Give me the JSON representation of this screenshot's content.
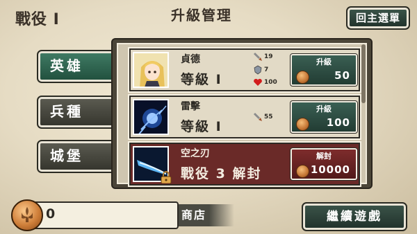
{
  "header": {
    "battle": "戰役 I",
    "title": "升級管理",
    "back_button": "回主選單"
  },
  "tabs": [
    {
      "label": "英雄",
      "active": true
    },
    {
      "label": "兵種",
      "active": false
    },
    {
      "label": "城堡",
      "active": false
    }
  ],
  "units": [
    {
      "name": "貞德",
      "level_text": "等級 I",
      "stats": {
        "attack": "19",
        "defense": "7",
        "hp": "100"
      },
      "action_label": "升級",
      "price": "50",
      "locked": false,
      "icon": "heroine-portrait"
    },
    {
      "name": "雷擊",
      "level_text": "等級 I",
      "stats": {
        "attack": "55"
      },
      "action_label": "升級",
      "price": "100",
      "locked": false,
      "icon": "lightning-orb-icon"
    },
    {
      "name": "空之刃",
      "level_text": "戰役 3 解封",
      "action_label": "解封",
      "price": "10000",
      "locked": true,
      "icon": "sky-blade-icon"
    }
  ],
  "footer": {
    "gold": "0",
    "shop_button": "商店",
    "continue_button": "繼續遊戲"
  },
  "colors": {
    "upgrade_button": "#2e4d43",
    "unlock_button": "#6e2424",
    "active_tab": "#2f6a52",
    "locked_row": "#6a2a28"
  }
}
